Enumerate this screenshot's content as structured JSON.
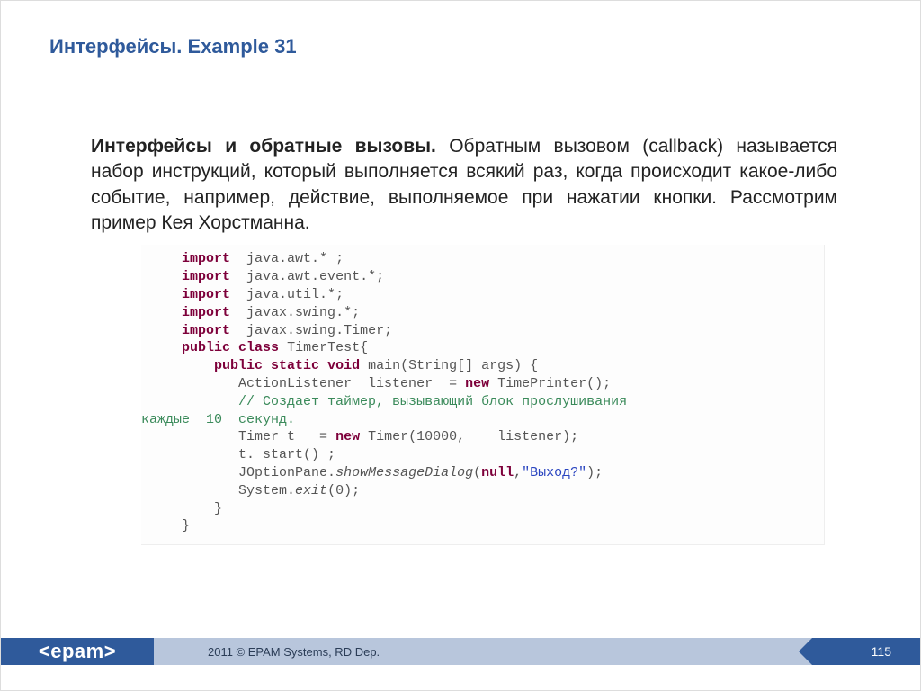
{
  "title": "Интерфейсы. Example 31",
  "paragraph": {
    "lead": "Интерфейсы и обратные вызовы.",
    "text": " Обратным вызовом (callback) называется набор инструкций, который выполняется всякий раз, когда происходит какое-либо событие, например, действие, выполняемое при нажатии кнопки. Рассмотрим пример Кея Хорстманна."
  },
  "code": {
    "kw_import": "import",
    "kw_public": "public",
    "kw_class": "class",
    "kw_static": "static",
    "kw_void": "void",
    "kw_new": "new",
    "kw_null": "null",
    "imp1": "java.awt.* ;",
    "imp2": "java.awt.event.*;",
    "imp3": "java.util.*;",
    "imp4": "javax.swing.*;",
    "imp5": "javax.swing.Timer;",
    "classdecl": "TimerTest{",
    "main_sig": "main(String[] args) {",
    "l1a": "ActionListener  listener  =",
    "l1b": "TimePrinter();",
    "comment1": "// Создает таймер, вызывающий блок прослушивания",
    "comment2": "каждые  10  секунд.",
    "l2a": "Timer t   =",
    "l2b": "Timer(10000,    listener);",
    "l3": "t. start() ;",
    "l4a": "JOptionPane.",
    "l4b": "showMessageDialog",
    "l4c": "(",
    "l4d": ",",
    "l4e": "\"Выход?\"",
    "l4f": ");",
    "l5a": "System.",
    "l5b": "exit",
    "l5c": "(0);",
    "brace": "}"
  },
  "footer": {
    "logo": "<epam>",
    "copyright": "2011 © EPAM Systems, RD Dep.",
    "page": "115"
  }
}
